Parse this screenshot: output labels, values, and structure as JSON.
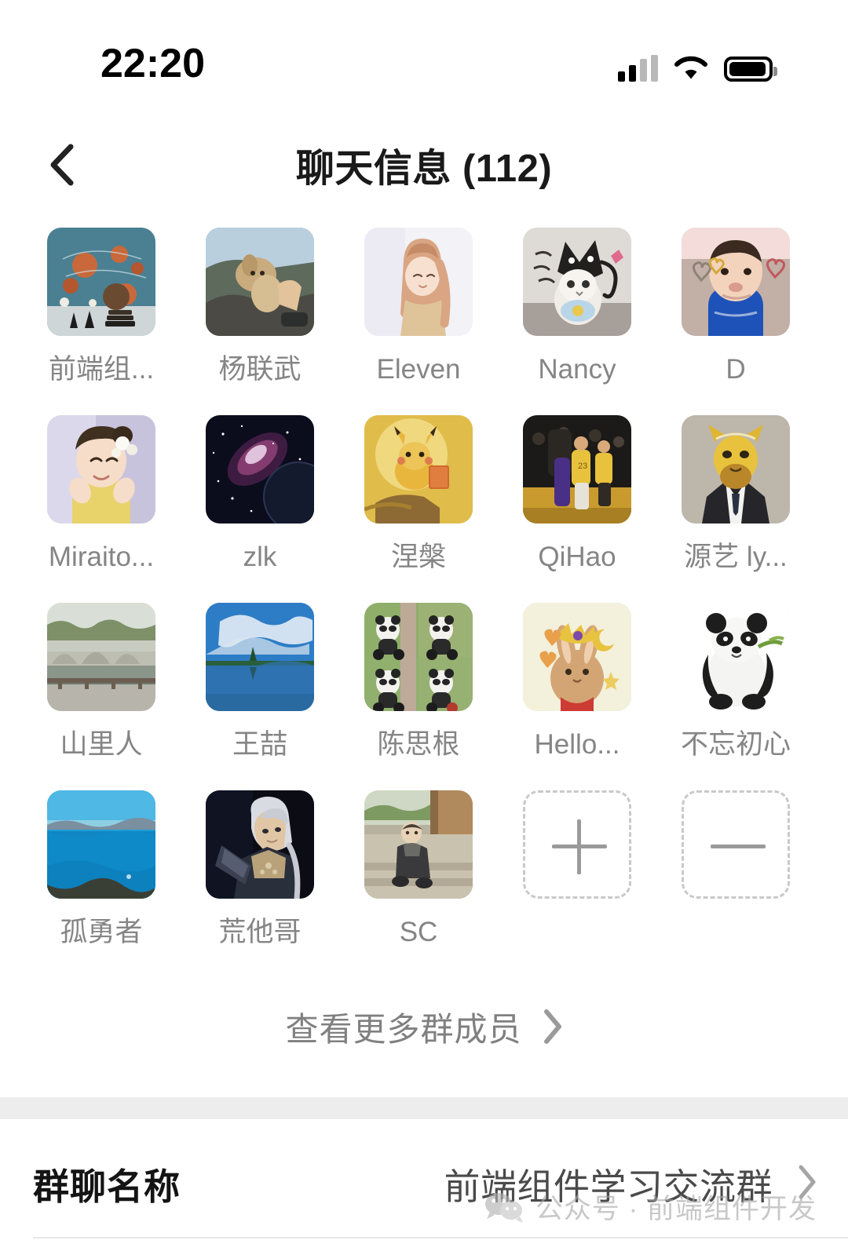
{
  "status_bar": {
    "time": "22:20",
    "signal_icon": "cellular-signal-icon",
    "wifi_icon": "wifi-icon",
    "battery_icon": "battery-icon"
  },
  "nav": {
    "back_icon": "chevron-left-icon",
    "title": "聊天信息 (112)"
  },
  "members": {
    "rows": [
      [
        {
          "name": "前端组...",
          "avatar": "group-avatar-planets"
        },
        {
          "name": "杨联武",
          "avatar": "avatar-dog-mountain"
        },
        {
          "name": "Eleven",
          "avatar": "avatar-anime-girl"
        },
        {
          "name": "Nancy",
          "avatar": "avatar-cat-shadow"
        },
        {
          "name": "D",
          "avatar": "avatar-baby-blue"
        }
      ],
      [
        {
          "name": "Miraito...",
          "avatar": "avatar-girl-flower"
        },
        {
          "name": "zlk",
          "avatar": "avatar-galaxy-planet"
        },
        {
          "name": "涅槃",
          "avatar": "avatar-pikachu"
        },
        {
          "name": "QiHao",
          "avatar": "avatar-basketball-court"
        },
        {
          "name": "源艺 ly...",
          "avatar": "avatar-lion-suit"
        }
      ],
      [
        {
          "name": "山里人",
          "avatar": "avatar-stone-bridge"
        },
        {
          "name": "王喆",
          "avatar": "avatar-lake-sky"
        },
        {
          "name": "陈思根",
          "avatar": "avatar-panda-collage"
        },
        {
          "name": "Hello...",
          "avatar": "avatar-rabbit-plush"
        },
        {
          "name": "不忘初心",
          "avatar": "avatar-panda-bamboo"
        }
      ],
      [
        {
          "name": "孤勇者",
          "avatar": "avatar-sea-view"
        },
        {
          "name": "荒他哥",
          "avatar": "avatar-game-warrior"
        },
        {
          "name": "SC",
          "avatar": "avatar-child-steps"
        }
      ]
    ],
    "add_member_icon": "plus-icon",
    "remove_member_icon": "minus-icon"
  },
  "view_more": {
    "label": "查看更多群成员",
    "chevron_icon": "chevron-right-icon"
  },
  "group_name_row": {
    "label": "群聊名称",
    "value": "前端组件学习交流群",
    "chevron_icon": "chevron-right-icon"
  },
  "watermark": {
    "icon": "wechat-bubble-icon",
    "text": "公众号 · 前端组件开发"
  },
  "colors": {
    "background": "#ffffff",
    "title_text": "#1a1a1a",
    "member_name_text": "#858585",
    "band": "#ededed",
    "ghost_border": "#c9c9c9"
  }
}
